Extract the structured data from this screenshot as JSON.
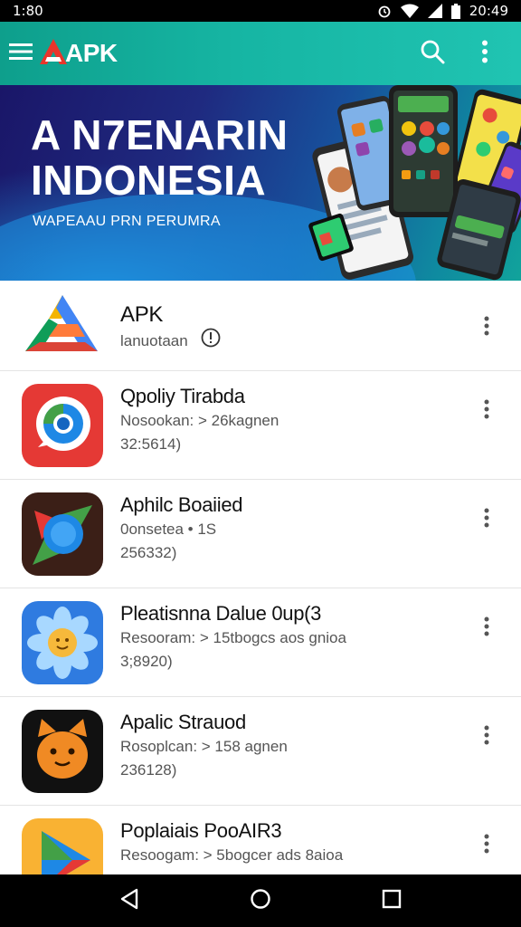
{
  "status_bar": {
    "time": "1:80",
    "clock_right": "20:49",
    "icons": [
      "alarm-icon",
      "wifi-icon",
      "signal-icon",
      "battery-icon"
    ]
  },
  "app_bar": {
    "logo_text": "APK",
    "icons": [
      "menu-icon",
      "search-icon",
      "more-vert-icon"
    ],
    "background": "#16b5a3"
  },
  "banner": {
    "title_line1": "A N7ENARIN",
    "title_line2": "INDONESIA",
    "subtitle": "WAPEAAU PRN PERUMRA"
  },
  "apps": [
    {
      "name": "APK",
      "lines": [
        "lanuotaan"
      ],
      "icon": "apk-logo-icon"
    },
    {
      "name": "Qpoliy Tirabda",
      "lines": [
        "Nosookan:  > 26kagnen",
        "32:5614)"
      ],
      "icon": "chat-bubble-app-icon"
    },
    {
      "name": "Aphilc Boaiied",
      "lines": [
        "0onsetea  • 1S",
        "256332)"
      ],
      "icon": "arrows-circle-app-icon"
    },
    {
      "name": "Pleatisnna Dalue 0up(3",
      "lines": [
        "Resooram:  > 15tbogcs     aos gnioa",
        "3;8920)"
      ],
      "icon": "sunflower-app-icon"
    },
    {
      "name": "Apalic Strauod",
      "lines": [
        "Rosoplcan:  > 158 agnen",
        "236128)"
      ],
      "icon": "cat-face-app-icon"
    },
    {
      "name": "Poplaiais          PooAIR3",
      "lines": [
        "Resoogam:  > 5bogcer   ads 8aioa"
      ],
      "icon": "play-triangle-app-icon"
    }
  ],
  "nav_bar": {
    "icons": [
      "back-icon",
      "home-icon",
      "recents-icon"
    ]
  }
}
